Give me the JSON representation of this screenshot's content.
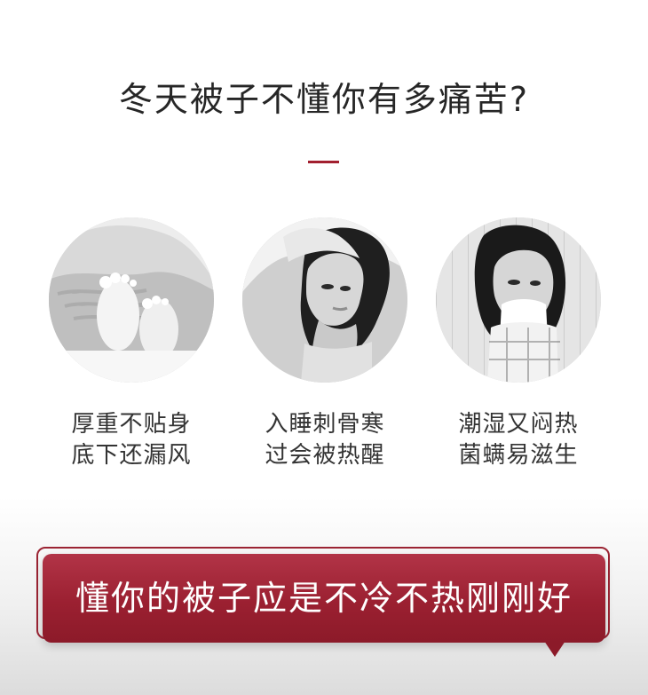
{
  "headline": "冬天被子不懂你有多痛苦?",
  "features": [
    {
      "line1": "厚重不贴身",
      "line2": "底下还漏风"
    },
    {
      "line1": "入睡刺骨寒",
      "line2": "过会被热醒"
    },
    {
      "line1": "潮湿又闷热",
      "line2": "菌螨易滋生"
    }
  ],
  "cta": {
    "label": "懂你的被子应是不冷不热刚刚好"
  },
  "colors": {
    "accent": "#a21f2f",
    "headline": "#262626",
    "caption": "#333333",
    "cta_text": "#ffffff"
  }
}
